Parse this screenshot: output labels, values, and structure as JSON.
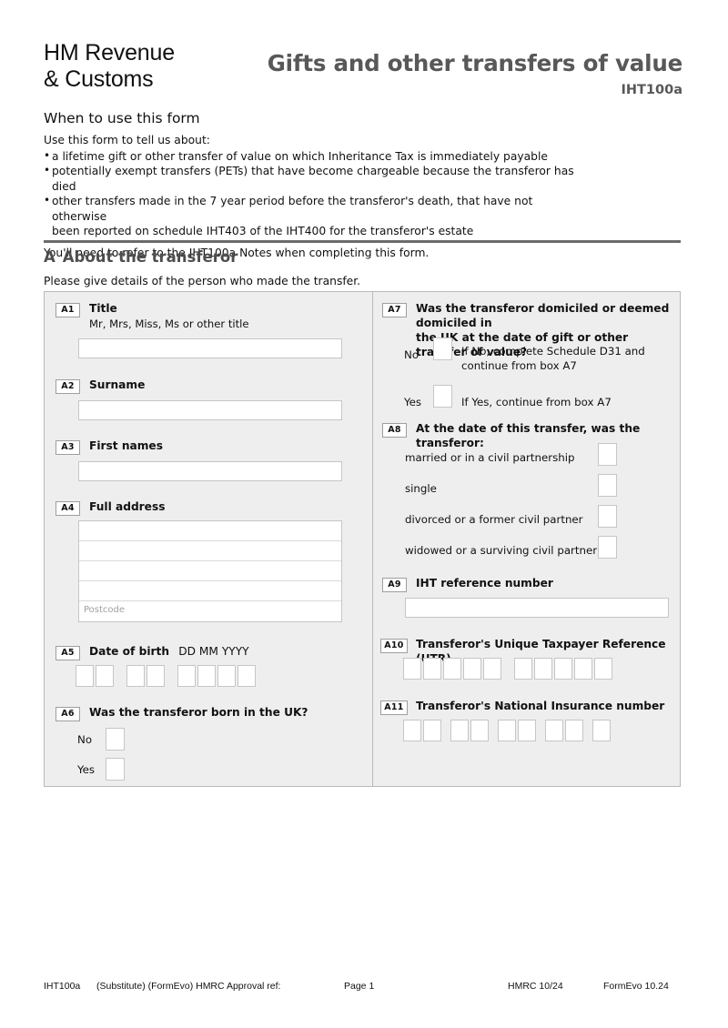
{
  "header": {
    "logo_line1": "HM Revenue",
    "logo_line2": "& Customs",
    "title": "Gifts and other transfers of value",
    "form_code": "IHT100a"
  },
  "intro": {
    "heading": "When to use this form",
    "lead": "Use this form to tell us about:",
    "bullets": [
      "a lifetime gift or other transfer of value on which Inheritance Tax is immediately payable",
      "potentially exempt transfers (PETs) that have become chargeable because the transferor has died",
      "other transfers made in the 7 year period before the transferor's death, that have not otherwise"
    ],
    "bullet3_continued": "been reported on schedule IHT403 of the IHT400 for the transferor's estate",
    "tail": "You'll need to refer to the IHT100a Notes when completing this form."
  },
  "section_a": {
    "letter": "A",
    "heading": "About the transferor",
    "subheading": "Please give details of the person who made the transfer.",
    "fields": {
      "a1": {
        "tag": "A1",
        "label": "Title",
        "hint": "Mr, Mrs, Miss, Ms or other title",
        "value": ""
      },
      "a2": {
        "tag": "A2",
        "label": "Surname",
        "value": ""
      },
      "a3": {
        "tag": "A3",
        "label": "First names",
        "value": ""
      },
      "a4": {
        "tag": "A4",
        "label": "Full address",
        "lines": [
          "",
          "",
          "",
          ""
        ],
        "postcode_placeholder": "Postcode",
        "postcode_value": ""
      },
      "a5": {
        "tag": "A5",
        "label": "Date of birth",
        "format_hint": "DD MM YYYY",
        "day_boxes": 2,
        "month_boxes": 2,
        "year_boxes": 4
      },
      "a6": {
        "tag": "A6",
        "label": "Was the transferor born in the UK?",
        "options": [
          {
            "label": "No",
            "checked": false
          },
          {
            "label": "Yes",
            "checked": false
          }
        ]
      },
      "a7": {
        "tag": "A7",
        "label_line1": "Was the transferor domiciled or deemed domiciled in",
        "label_line2": "the UK at the date of gift or other transfer of value?",
        "options": [
          {
            "label": "No",
            "checked": false,
            "note_line1": "If No, complete Schedule D31 and",
            "note_line2": "continue from box A7"
          },
          {
            "label": "Yes",
            "checked": false,
            "note_line1": "If Yes, continue from box A7",
            "note_line2": ""
          }
        ]
      },
      "a8": {
        "tag": "A8",
        "label": "At the date of this transfer, was the transferor:",
        "options": [
          {
            "label": "married or in a civil partnership",
            "checked": false
          },
          {
            "label": "single",
            "checked": false
          },
          {
            "label": "divorced or a former civil partner",
            "checked": false
          },
          {
            "label": "widowed or a surviving civil partner",
            "checked": false
          }
        ]
      },
      "a9": {
        "tag": "A9",
        "label": "IHT reference number",
        "value": ""
      },
      "a10": {
        "tag": "A10",
        "label": "Transferor's Unique Taxpayer Reference (UTR)",
        "group1_boxes": 5,
        "group2_boxes": 5
      },
      "a11": {
        "tag": "A11",
        "label": "Transferor's National Insurance number",
        "groups": [
          2,
          2,
          2,
          2,
          1
        ]
      }
    }
  },
  "footer": {
    "form_ref": "IHT100a",
    "substitute_note": "(Substitute) (FormEvo) HMRC Approval ref:",
    "page": "Page 1",
    "hmrc_date": "HMRC 10/24",
    "formevo_version": "FormEvo 10.24"
  }
}
